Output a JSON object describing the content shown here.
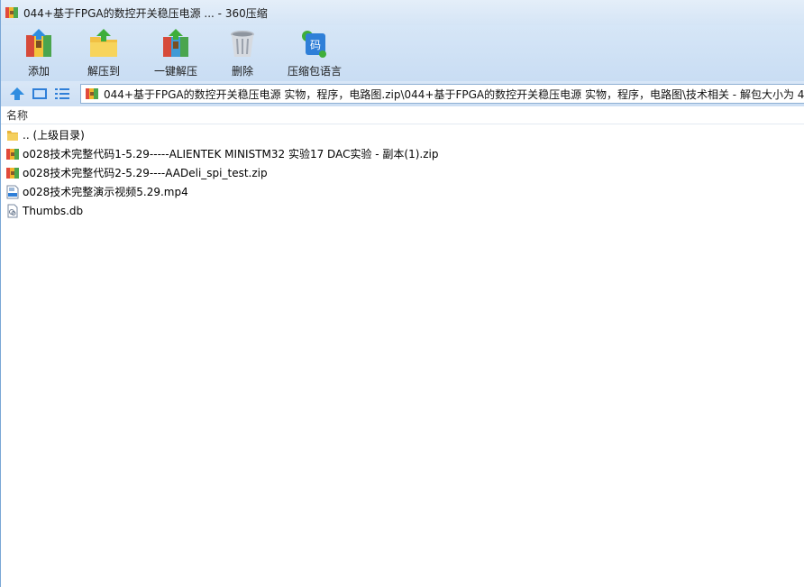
{
  "window": {
    "title": "044+基于FPGA的数控开关稳压电源  ... - 360压缩"
  },
  "toolbar": {
    "buttons": [
      {
        "label": "添加",
        "icon": "add-archive-icon"
      },
      {
        "label": "解压到",
        "icon": "extract-to-icon"
      },
      {
        "label": "一键解压",
        "icon": "one-click-extract-icon"
      },
      {
        "label": "删除",
        "icon": "delete-trash-icon"
      },
      {
        "label": "压缩包语言",
        "icon": "archive-language-icon"
      }
    ]
  },
  "addressbar": {
    "path": "044+基于FPGA的数控开关稳压电源  实物，程序，电路图.zip\\044+基于FPGA的数控开关稳压电源  实物，程序，电路图\\技术相关 - 解包大小为 4"
  },
  "list": {
    "column_name": "名称",
    "items": [
      {
        "name": ".. (上级目录)",
        "icon": "folder-up-icon"
      },
      {
        "name": "o028技术完整代码1-5.29-----ALIENTEK MINISTM32 实验17 DAC实验 - 副本(1).zip",
        "icon": "zip-archive-icon"
      },
      {
        "name": "o028技术完整代码2-5.29----AADeli_spi_test.zip",
        "icon": "zip-archive-icon"
      },
      {
        "name": "o028技术完整演示视频5.29.mp4",
        "icon": "mp4-file-icon"
      },
      {
        "name": "Thumbs.db",
        "icon": "db-file-icon"
      }
    ]
  },
  "colors": {
    "toolbar_bg": "#cfe0f5",
    "border": "#8fb0d4"
  }
}
